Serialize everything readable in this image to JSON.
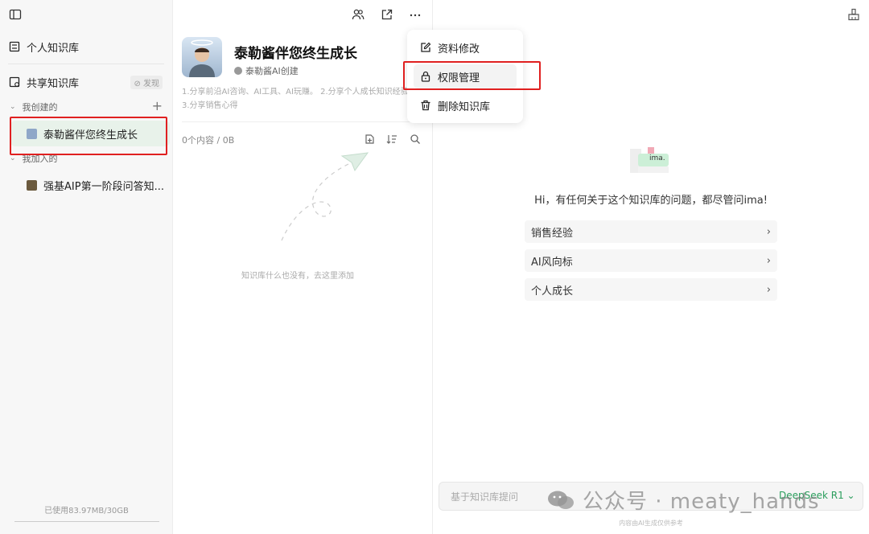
{
  "sidebar": {
    "personal_kb": "个人知识库",
    "shared_kb": "共享知识库",
    "discover": "⊘ 发现",
    "created_section": "我创建的",
    "joined_section": "我加入的",
    "created_items": [
      "泰勒酱伴您终生成长"
    ],
    "joined_items": [
      "强基AIP第一阶段问答知..."
    ],
    "storage": "已使用83.97MB/30GB"
  },
  "kb": {
    "title": "泰勒酱伴您终生成长",
    "creator": "泰勒酱AI创建",
    "description": "1.分享前沿AI咨询、AI工具、AI玩赚。 2.分享个人成长知识经验 3.分享销售心得",
    "count": "0个内容 / 0B",
    "empty_text": "知识库什么也没有，去这里添加"
  },
  "menu": {
    "items": [
      "资料修改",
      "权限管理",
      "删除知识库"
    ]
  },
  "chat": {
    "greeting": "Hi，有任何关于这个知识库的问题，都尽管问ima!",
    "suggestions": [
      "销售经验",
      "AI风向标",
      "个人成长"
    ],
    "input_placeholder": "基于知识库提问",
    "model": "DeepSeek R1 ⌄",
    "disclaimer": "内容由AI生成仅供参考",
    "logo_text": "ima."
  },
  "watermark": "公众号 · meaty_hands",
  "colors": {
    "accent": "#2a9d5c",
    "highlight": "#e02020",
    "active_bg": "#e8f2ea"
  }
}
